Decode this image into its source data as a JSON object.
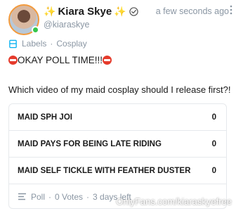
{
  "author": {
    "display_name": "Kiara Skye",
    "sparkle_left": "✨",
    "sparkle_right": "✨",
    "username": "@kiaraskye",
    "timestamp": "a few seconds ago",
    "online": true
  },
  "labels": {
    "prefix": "Labels",
    "separator": "·",
    "items": [
      "Cosplay"
    ]
  },
  "post": {
    "title": "OKAY POLL TIME!!!",
    "body": "Which video of my maid cosplay should I release first?!"
  },
  "poll": {
    "options": [
      {
        "label": "MAID SPH JOI",
        "votes": "0"
      },
      {
        "label": "MAID PAYS FOR BEING LATE RIDING",
        "votes": "0"
      },
      {
        "label": "MAID SELF TICKLE WITH FEATHER DUSTER",
        "votes": "0"
      }
    ],
    "footer": {
      "type": "Poll",
      "separator": "·",
      "votes": "0 Votes",
      "time_left": "3 days left"
    }
  },
  "watermark": "OnlyFans.com/kiaraskyefree",
  "colors": {
    "muted": "#8a96a3",
    "online": "#35c64a",
    "stop_sign": "#e53b2c",
    "avatar_ring": "#f39a3c"
  },
  "icons": [
    "verified-icon",
    "more-icon",
    "tag-icon",
    "poll-icon",
    "stop-sign-icon",
    "sparkles-icon"
  ]
}
